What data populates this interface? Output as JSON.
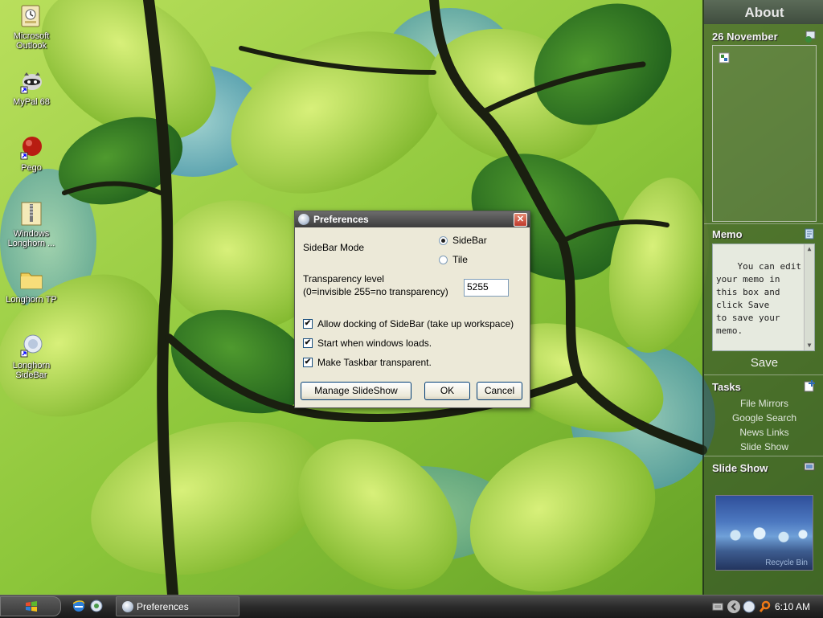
{
  "desktop": {
    "icons": [
      {
        "label": "Microsoft Outlook",
        "icon": "outlook-icon"
      },
      {
        "label": "MyPal 68",
        "icon": "raccoon-icon"
      },
      {
        "label": "Pego",
        "icon": "red-ball-icon"
      },
      {
        "label": "Windows Longhorn ...",
        "icon": "zip-folder-icon"
      },
      {
        "label": "Longhorn TP",
        "icon": "folder-icon"
      },
      {
        "label": "Longhorn SideBar",
        "icon": "sidebar-icon"
      }
    ]
  },
  "sidebar": {
    "about": "About",
    "date": "26 November",
    "memo_title": "Memo",
    "memo_text": "You can edit\nyour memo in\nthis box and\nclick Save\nto save your\nmemo.",
    "save": "Save",
    "tasks_title": "Tasks",
    "tasks": [
      "File Mirrors",
      "Google Search",
      "News Links",
      "Slide Show"
    ],
    "slideshow_title": "Slide Show",
    "slideshow_caption": "Recycle Bin"
  },
  "dialog": {
    "title": "Preferences",
    "close": "✕",
    "sidebar_mode_label": "SideBar Mode",
    "mode_options": [
      {
        "label": "SideBar",
        "selected": true
      },
      {
        "label": "Tile",
        "selected": false
      }
    ],
    "transparency_label": "Transparency level",
    "transparency_hint": "(0=invisible 255=no transparency)",
    "transparency_value": "5255",
    "checkboxes": [
      {
        "label": "Allow docking of SideBar (take up workspace)",
        "checked": true
      },
      {
        "label": "Start when windows loads.",
        "checked": true
      },
      {
        "label": "Make Taskbar transparent.",
        "checked": true
      }
    ],
    "buttons": {
      "manage": "Manage SlideShow",
      "ok": "OK",
      "cancel": "Cancel"
    }
  },
  "taskbar": {
    "task_label": "Preferences",
    "clock": "6:10 AM"
  }
}
